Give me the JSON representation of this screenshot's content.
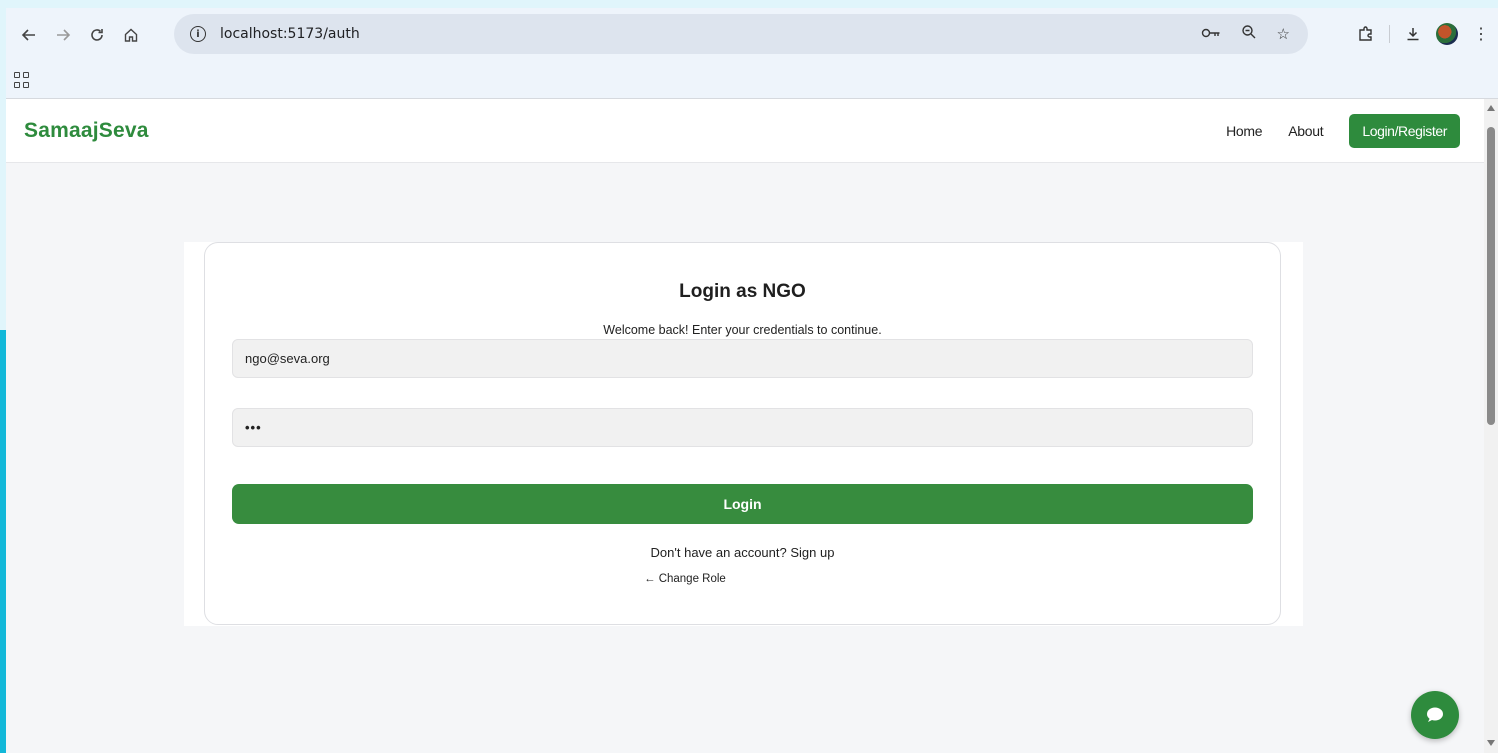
{
  "browser": {
    "url": "localhost:5173/auth"
  },
  "navbar": {
    "brand": "SamaajSeva",
    "links": [
      "Home",
      "About"
    ],
    "cta": "Login/Register"
  },
  "login": {
    "title": "Login as NGO",
    "subtitle": "Welcome back! Enter your credentials to continue.",
    "email_value": "ngo@seva.org",
    "password_value": "•••",
    "button": "Login",
    "signup_text": "Don't have an account? Sign up",
    "change_role": "← Change Role"
  },
  "colors": {
    "brand": "#2e8b3d",
    "frame": "#e0f5fb",
    "page_bg": "#f5f6f8"
  },
  "icons": [
    "back-icon",
    "forward-icon",
    "reload-icon",
    "home-icon",
    "site-info-icon",
    "password-key-icon",
    "zoom-icon",
    "bookmark-star-icon",
    "extensions-icon",
    "download-icon",
    "profile-avatar",
    "menu-kebab-icon",
    "apps-grid-icon",
    "chat-bubble-icon"
  ]
}
